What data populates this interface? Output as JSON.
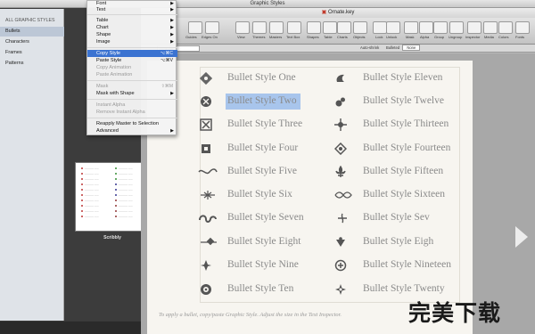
{
  "graphic_styles": {
    "title": "Graphic Styles",
    "sidebar": {
      "header": "ALL GRAPHIC STYLES",
      "items": [
        "Bullets",
        "Characters",
        "Frames",
        "Patterns"
      ]
    },
    "thumbnail_caption": "Scribbly"
  },
  "context_menu": {
    "items": [
      {
        "label": "Font",
        "submenu": true
      },
      {
        "label": "Text",
        "submenu": true
      },
      {
        "label": "Table",
        "submenu": true
      },
      {
        "label": "Chart",
        "submenu": true
      },
      {
        "label": "Shape",
        "submenu": true
      },
      {
        "label": "Image",
        "submenu": true
      },
      {
        "label": "Copy Style",
        "shortcut": "⌥⌘C",
        "highlighted": true
      },
      {
        "label": "Paste Style",
        "shortcut": "⌥⌘V"
      },
      {
        "label": "Copy Animation",
        "disabled": true
      },
      {
        "label": "Paste Animation",
        "disabled": true
      },
      {
        "label": "Mask",
        "shortcut": "⇧⌘M",
        "disabled": true
      },
      {
        "label": "Mask with Shape",
        "submenu": true
      },
      {
        "label": "Instant Alpha",
        "disabled": true
      },
      {
        "label": "Remove Instant Alpha",
        "disabled": true
      },
      {
        "label": "Reapply Master to Selection"
      },
      {
        "label": "Advanced",
        "submenu": true
      }
    ]
  },
  "keynote": {
    "document_title": "Ornate.key",
    "toolbar": [
      "Guides",
      "Edges On",
      "View",
      "Themes",
      "Masters",
      "Text Box",
      "Shapes",
      "Table",
      "Charts",
      "Objects",
      "Lock",
      "Unlock",
      "Mask",
      "Alpha",
      "Group",
      "Ungroup",
      "Inspector",
      "Media",
      "Colors",
      "Fonts"
    ],
    "format_bar": {
      "font": "Regular",
      "size_label": "Auto-shrink",
      "bullets_label": "Bulleted",
      "bullets_value": "None"
    },
    "bullets_left": [
      "Bullet Style One",
      "Bullet Style Two",
      "Bullet Style Three",
      "Bullet Style Four",
      "Bullet Style Five",
      "Bullet Style Six",
      "Bullet Style Seven",
      "Bullet Style Eight",
      "Bullet Style Nine",
      "Bullet Style Ten"
    ],
    "bullets_right": [
      "Bullet Style Eleven",
      "Bullet Style Twelve",
      "Bullet Style Thirteen",
      "Bullet Style Fourteen",
      "Bullet Style Fifteen",
      "Bullet Style Sixteen",
      "Bullet Style Sev",
      "Bullet Style Eigh",
      "Bullet Style Nineteen",
      "Bullet Style Twenty"
    ],
    "slide_note": "To apply a bullet, copy/paste Graphic Style. Adjust the size in the Text Inspector."
  },
  "watermark": "完美下载"
}
